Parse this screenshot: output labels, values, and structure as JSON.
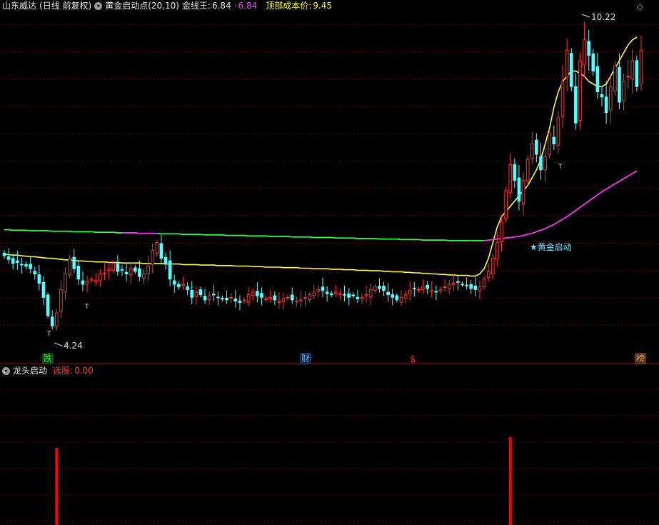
{
  "header": {
    "stock_name": "山东威达",
    "period": "(日线 前复权)",
    "indicator": "黄金启动点(20,10)",
    "gold_line_label": "金线王:",
    "gold_line_value": "6.84",
    "gold_line_value2": "6.84",
    "top_cost_label": "顶部成本价:",
    "top_cost_value": "9.45"
  },
  "subpanel": {
    "title": "龙头启动",
    "select_label": "选股:",
    "select_value": "0.00"
  },
  "annotations": {
    "high": "10.22",
    "low": "4.24",
    "start_signal": "★黄金启动",
    "marker_t": "T"
  },
  "badges": [
    {
      "text": "跌",
      "color": "#22cc22"
    },
    {
      "text": "财",
      "color": "#4d9bff"
    },
    {
      "text": "$",
      "color": "#ff3333"
    },
    {
      "text": "榜",
      "color": "#ff9933"
    }
  ],
  "colors": {
    "up": "#ff3232",
    "down": "#54ffff",
    "yellow_line": "#ffff33",
    "green_line": "#33ff33",
    "magenta_line": "#ff33ff",
    "grid": "#6b0000",
    "signal_bar": "#ff0000"
  },
  "chart_data": {
    "type": "candlestick",
    "ylim": [
      3.9,
      10.6
    ],
    "high": 10.22,
    "low": 4.24,
    "closes": [
      5.85,
      5.78,
      5.7,
      5.72,
      5.68,
      5.65,
      5.6,
      5.5,
      5.32,
      5.05,
      4.7,
      4.5,
      4.75,
      5.2,
      5.5,
      5.8,
      5.6,
      5.4,
      5.3,
      5.35,
      5.4,
      5.38,
      5.5,
      5.52,
      5.6,
      5.7,
      5.55,
      5.58,
      5.5,
      5.6,
      5.55,
      5.45,
      5.5,
      5.65,
      5.95,
      6.1,
      5.8,
      5.7,
      5.4,
      5.3,
      5.25,
      5.3,
      5.2,
      5.05,
      5.15,
      5.1,
      5.0,
      5.08,
      5.1,
      5.05,
      5.02,
      5.0,
      5.05,
      4.98,
      4.95,
      5.0,
      5.1,
      5.15,
      5.08,
      5.05,
      5.02,
      5.05,
      5.0,
      4.98,
      5.03,
      5.05,
      5.0,
      4.98,
      5.0,
      5.05,
      5.1,
      5.15,
      5.2,
      5.18,
      5.12,
      5.1,
      5.15,
      5.12,
      5.1,
      5.05,
      5.08,
      5.02,
      5.05,
      5.1,
      5.2,
      5.25,
      5.22,
      5.18,
      5.1,
      5.05,
      5.0,
      5.05,
      5.1,
      5.18,
      5.22,
      5.2,
      5.25,
      5.22,
      5.18,
      5.15,
      5.2,
      5.25,
      5.3,
      5.32,
      5.35,
      5.3,
      5.28,
      5.22,
      5.2,
      5.25,
      5.4,
      5.55,
      5.8,
      6.1,
      6.5,
      7.1,
      7.6,
      7.3,
      6.9,
      7.3,
      7.7,
      8.0,
      7.8,
      7.5,
      7.75,
      8.2,
      8.0,
      8.5,
      9.2,
      9.8,
      9.1,
      8.4,
      9.6,
      10.0,
      9.7,
      9.4,
      9.0,
      8.9,
      8.6,
      9.1,
      9.5,
      8.8,
      9.2,
      9.3,
      9.6,
      9.1,
      9.8
    ],
    "ma_yellow": [
      5.88,
      5.87,
      5.86,
      5.86,
      5.85,
      5.84,
      5.83,
      5.83,
      5.82,
      5.81,
      5.8,
      5.8,
      5.79,
      5.78,
      5.77,
      5.77,
      5.76,
      5.75,
      5.75,
      5.74,
      5.74,
      5.73,
      5.73,
      5.73,
      5.72,
      5.72,
      5.72,
      5.71,
      5.71,
      5.71,
      5.71,
      5.71,
      5.7,
      5.7,
      5.7,
      5.7,
      5.7,
      5.69,
      5.69,
      5.69,
      5.69,
      5.68,
      5.68,
      5.68,
      5.68,
      5.67,
      5.67,
      5.67,
      5.67,
      5.66,
      5.66,
      5.66,
      5.66,
      5.65,
      5.65,
      5.65,
      5.65,
      5.64,
      5.64,
      5.64,
      5.63,
      5.63,
      5.63,
      5.63,
      5.62,
      5.62,
      5.62,
      5.62,
      5.61,
      5.61,
      5.61,
      5.6,
      5.6,
      5.6,
      5.6,
      5.59,
      5.59,
      5.59,
      5.58,
      5.58,
      5.58,
      5.57,
      5.57,
      5.57,
      5.56,
      5.56,
      5.56,
      5.55,
      5.55,
      5.54,
      5.54,
      5.54,
      5.53,
      5.53,
      5.52,
      5.52,
      5.51,
      5.51,
      5.5,
      5.5,
      5.49,
      5.49,
      5.48,
      5.48,
      5.47,
      5.47,
      5.47,
      5.46,
      5.46,
      5.5,
      5.6,
      5.8,
      6.1,
      6.4,
      6.6,
      6.7,
      6.8,
      6.9,
      7.0,
      7.1,
      7.2,
      7.35,
      7.5,
      7.7,
      8.0,
      8.3,
      8.7,
      9.0,
      9.2,
      9.3,
      9.4,
      9.4,
      9.35,
      9.3,
      9.2,
      9.15,
      9.1,
      9.1,
      9.15,
      9.3,
      9.45,
      9.6,
      9.75,
      9.9,
      10.0,
      10.05
    ],
    "ma_long": [
      6.35,
      6.35,
      6.34,
      6.34,
      6.34,
      6.34,
      6.33,
      6.33,
      6.33,
      6.33,
      6.33,
      6.32,
      6.32,
      6.32,
      6.32,
      6.32,
      6.31,
      6.31,
      6.31,
      6.31,
      6.31,
      6.3,
      6.3,
      6.3,
      6.3,
      6.3,
      6.29,
      6.29,
      6.29,
      6.29,
      6.29,
      6.28,
      6.28,
      6.28,
      6.28,
      6.28,
      6.27,
      6.27,
      6.27,
      6.27,
      6.27,
      6.26,
      6.26,
      6.26,
      6.26,
      6.26,
      6.25,
      6.25,
      6.25,
      6.25,
      6.25,
      6.24,
      6.24,
      6.24,
      6.24,
      6.24,
      6.23,
      6.23,
      6.23,
      6.23,
      6.23,
      6.22,
      6.22,
      6.22,
      6.22,
      6.22,
      6.21,
      6.21,
      6.21,
      6.21,
      6.21,
      6.2,
      6.2,
      6.2,
      6.2,
      6.2,
      6.19,
      6.19,
      6.19,
      6.19,
      6.19,
      6.18,
      6.18,
      6.18,
      6.18,
      6.18,
      6.17,
      6.17,
      6.17,
      6.17,
      6.17,
      6.16,
      6.16,
      6.16,
      6.16,
      6.16,
      6.15,
      6.15,
      6.15,
      6.15,
      6.15,
      6.15,
      6.14,
      6.14,
      6.14,
      6.14,
      6.14,
      6.14,
      6.14,
      6.14,
      6.14,
      6.15,
      6.16,
      6.17,
      6.18,
      6.19,
      6.2,
      6.21,
      6.22,
      6.24,
      6.26,
      6.28,
      6.31,
      6.34,
      6.37,
      6.41,
      6.45,
      6.5,
      6.55,
      6.6,
      6.66,
      6.72,
      6.78,
      6.84,
      6.9,
      6.96,
      7.02,
      7.08,
      7.13,
      7.18,
      7.23,
      7.28,
      7.33,
      7.38,
      7.43,
      7.48
    ],
    "signal_bars": [
      {
        "index": 12,
        "value": 1
      },
      {
        "index": 116,
        "value": 1
      }
    ]
  }
}
